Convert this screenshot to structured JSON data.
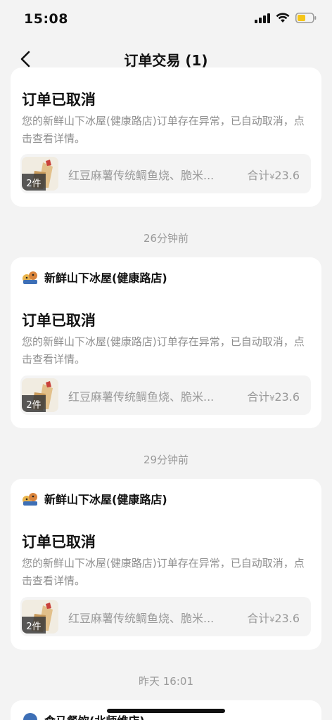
{
  "status": {
    "time": "15:08"
  },
  "nav": {
    "title": "订单交易 (1)"
  },
  "cards": [
    {
      "store": "",
      "title": "订单已取消",
      "desc": "您的新鲜山下冰屋(健康路店)订单存在异常，已自动取消，点击查看详情。",
      "count": "2件",
      "items": "红豆麻薯传统鲷鱼烧、脆米...",
      "total_label": "合计",
      "currency": "¥",
      "total": "23.6"
    },
    {
      "store": "新鲜山下冰屋(健康路店)",
      "title": "订单已取消",
      "desc": "您的新鲜山下冰屋(健康路店)订单存在异常，已自动取消，点击查看详情。",
      "count": "2件",
      "items": "红豆麻薯传统鲷鱼烧、脆米...",
      "total_label": "合计",
      "currency": "¥",
      "total": "23.6"
    },
    {
      "store": "新鲜山下冰屋(健康路店)",
      "title": "订单已取消",
      "desc": "您的新鲜山下冰屋(健康路店)订单存在异常，已自动取消，点击查看详情。",
      "count": "2件",
      "items": "红豆麻薯传统鲷鱼烧、脆米...",
      "total_label": "合计",
      "currency": "¥",
      "total": "23.6"
    },
    {
      "store": "食马餐饮(北师维店)"
    }
  ],
  "time_separators": [
    "26分钟前",
    "29分钟前",
    "昨天 16:01"
  ],
  "colors": {
    "background": "#f3f3f3",
    "card": "#ffffff",
    "muted_text": "#8e8e8e",
    "battery": "#f5c518"
  }
}
